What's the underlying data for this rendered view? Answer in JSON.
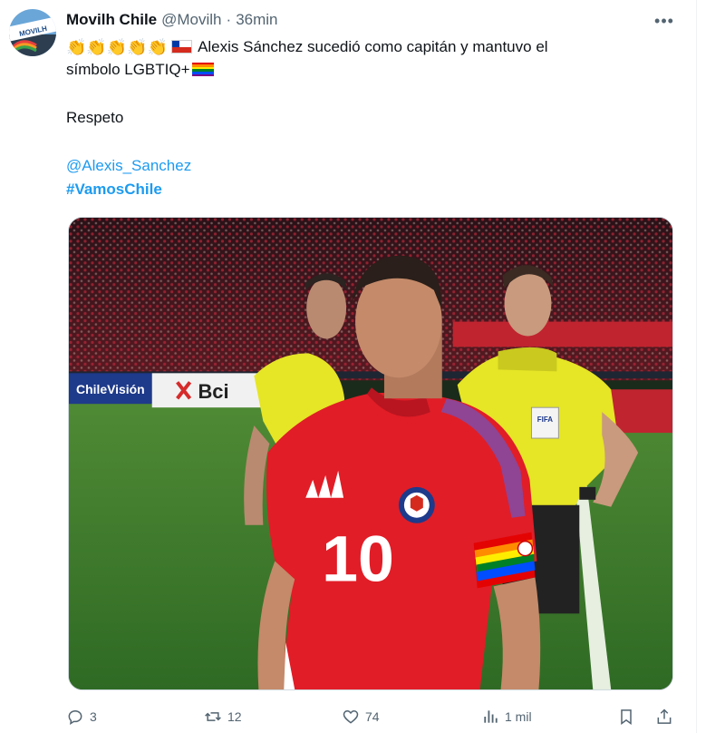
{
  "account": {
    "display_name": "Movilh Chile",
    "handle": "@Movilh",
    "separator": "·",
    "time": "36min",
    "avatar_label": "MOVILH"
  },
  "tweet": {
    "line1_text": "Alexis Sánchez sucedió como capitán y mantuvo el",
    "line2_text": "símbolo LGBTIQ+",
    "emoji_claps": "👏👏👏👏👏",
    "respeto": "Respeto",
    "mention": "@Alexis_Sanchez",
    "hashtag": "#VamosChile"
  },
  "media": {
    "boards": [
      "ChileVisión",
      "Bci"
    ],
    "player_number": "10",
    "referee_badge": "FIFA"
  },
  "actions": {
    "reply_count": "3",
    "retweet_count": "12",
    "like_count": "74",
    "views_count": "1 mil"
  },
  "colors": {
    "accent": "#1d9bf0",
    "muted": "#536471",
    "shirt_red": "#e11d27",
    "referee_yellow": "#e6e526",
    "pitch_green": "#3e7a2c"
  },
  "icons": [
    "more-icon",
    "reply-icon",
    "retweet-icon",
    "like-icon",
    "views-icon",
    "bookmark-icon",
    "share-icon"
  ]
}
